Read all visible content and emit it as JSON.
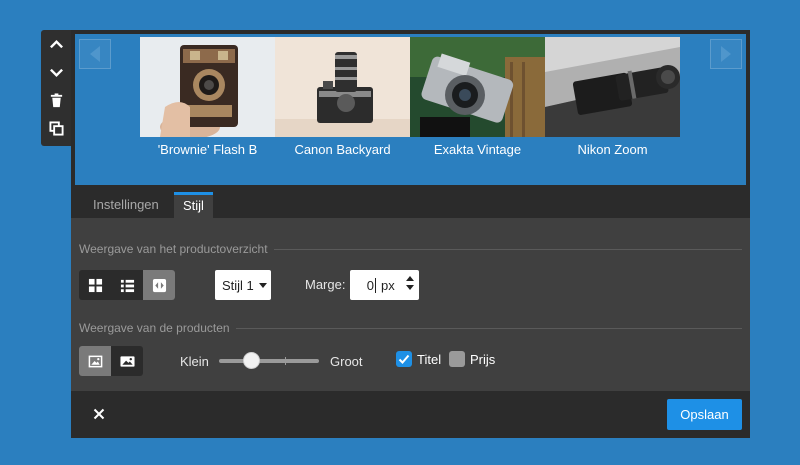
{
  "sidetools": {
    "items": [
      {
        "icon": "chevron-up-icon"
      },
      {
        "icon": "chevron-down-icon"
      },
      {
        "icon": "trash-icon"
      },
      {
        "icon": "duplicate-icon"
      }
    ]
  },
  "carousel": {
    "products": [
      {
        "title": "'Brownie' Flash B"
      },
      {
        "title": "Canon Backyard"
      },
      {
        "title": "Exakta Vintage"
      },
      {
        "title": "Nikon Zoom"
      }
    ]
  },
  "tabs": [
    {
      "label": "Instellingen",
      "active": false
    },
    {
      "label": "Stijl",
      "active": true
    }
  ],
  "panel": {
    "overview_section": "Weergave van het productoverzicht",
    "style_select": "Stijl 1",
    "margin_label": "Marge:",
    "margin_value": "0",
    "margin_unit": "px",
    "products_section": "Weergave van de producten",
    "size_small": "Klein",
    "size_large": "Groot",
    "size_value": 0.32,
    "check_title": "Titel",
    "check_title_checked": true,
    "check_price": "Prijs",
    "check_price_checked": false
  },
  "footer": {
    "save": "Opslaan"
  },
  "colors": {
    "background": "#2b7fbf",
    "dark": "#2b2b2b",
    "panel": "#404040",
    "accent": "#1e90e6"
  }
}
